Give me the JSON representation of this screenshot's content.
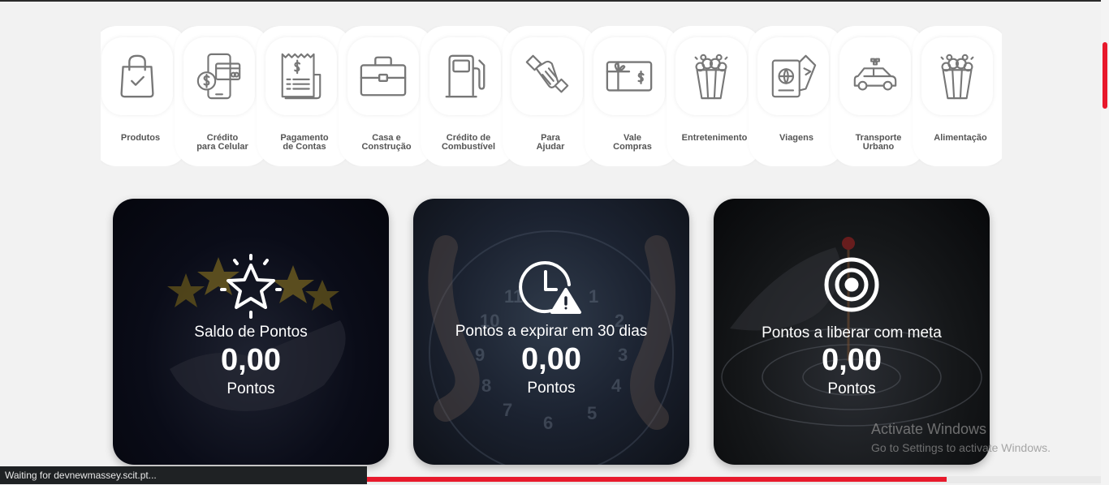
{
  "categories": [
    {
      "label": "Produtos",
      "icon": "shopping-bag-icon"
    },
    {
      "label": "Crédito\npara Celular",
      "icon": "phone-credit-icon"
    },
    {
      "label": "Pagamento\nde Contas",
      "icon": "bill-receipt-icon"
    },
    {
      "label": "Casa e\nConstrução",
      "icon": "briefcase-icon"
    },
    {
      "label": "Crédito de\nCombustível",
      "icon": "fuel-pump-icon"
    },
    {
      "label": "Para\nAjudar",
      "icon": "handshake-icon"
    },
    {
      "label": "Vale\nCompras",
      "icon": "gift-card-icon"
    },
    {
      "label": "Entretenimento",
      "icon": "popcorn-icon"
    },
    {
      "label": "Viagens",
      "icon": "passport-ticket-icon"
    },
    {
      "label": "Transporte\nUrbano",
      "icon": "taxi-icon"
    },
    {
      "label": "Alimentação",
      "icon": "popcorn-icon"
    }
  ],
  "cards": [
    {
      "title": "Saldo de Pontos",
      "value": "0,00",
      "unit": "Pontos",
      "icon": "star-icon"
    },
    {
      "title": "Pontos a expirar em 30 dias",
      "value": "0,00",
      "unit": "Pontos",
      "icon": "clock-warning-icon"
    },
    {
      "title": "Pontos a liberar com meta",
      "value": "0,00",
      "unit": "Pontos",
      "icon": "target-icon"
    }
  ],
  "watermark": {
    "line1": "Activate Windows",
    "line2": "Go to Settings to activate Windows."
  },
  "status": {
    "text": "Waiting for devnewmassey.scit.pt...",
    "progress": 0.79
  },
  "colors": {
    "accent": "#e8192c",
    "icon_stroke": "#777777"
  }
}
